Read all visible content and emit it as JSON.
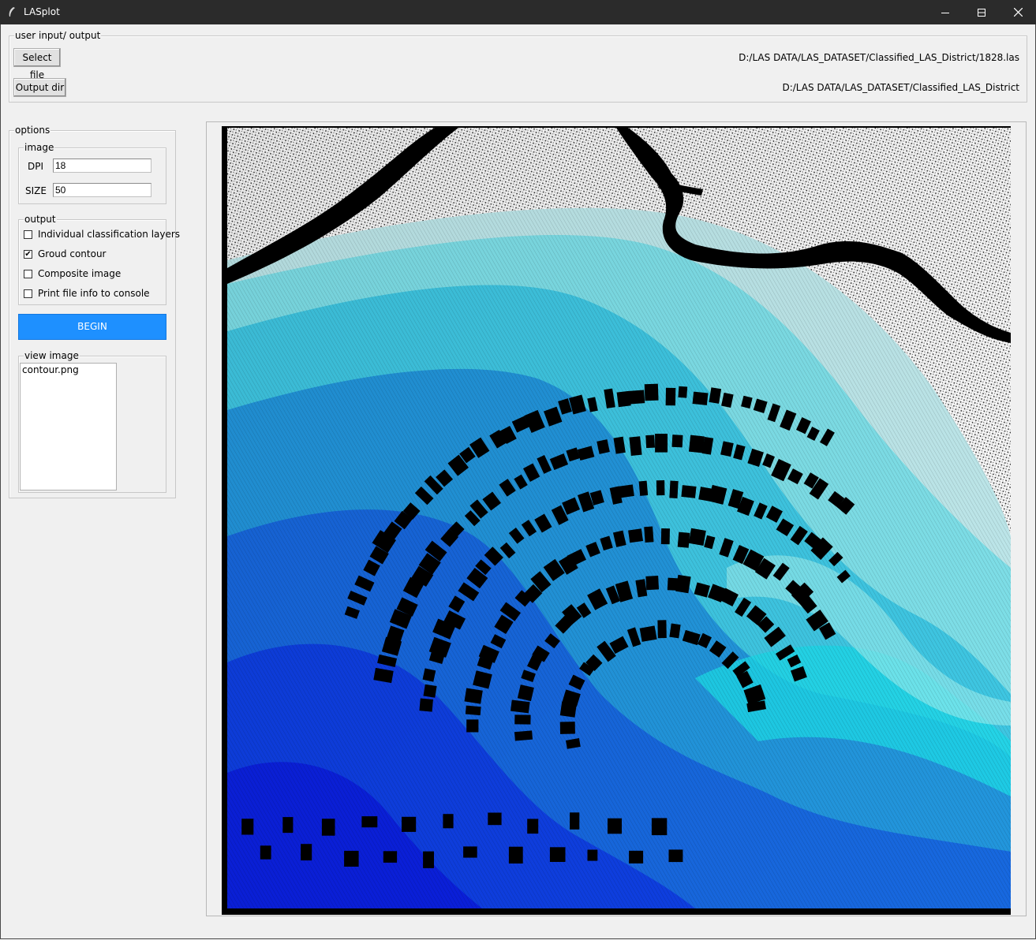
{
  "window": {
    "title": "LASplot",
    "minimize_glyph": "—",
    "maximize_glyph": "☐",
    "close_glyph": "✕"
  },
  "io_group": {
    "legend": "user input/ output",
    "select_file_label": "Select file",
    "output_dir_label": "Output dir",
    "input_path": "D:/LAS DATA/LAS_DATASET/Classified_LAS_District/1828.las",
    "output_path": "D:/LAS DATA/LAS_DATASET/Classified_LAS_District"
  },
  "options": {
    "legend": "options",
    "image": {
      "legend": "image",
      "dpi_label": "DPI",
      "dpi_value": "18",
      "size_label": "SIZE",
      "size_value": "50"
    },
    "output": {
      "legend": "output",
      "items": [
        {
          "label": "Individual classification layers",
          "checked": false
        },
        {
          "label": "Groud contour",
          "checked": true
        },
        {
          "label": "Composite image",
          "checked": false
        },
        {
          "label": "Print file info to console",
          "checked": false
        }
      ]
    },
    "begin_label": "BEGIN",
    "begin_color": "#1e90ff",
    "view_image": {
      "legend": "view image",
      "files": [
        "contour.png"
      ]
    }
  },
  "colors": {
    "titlebar": "#2b2b2b",
    "window_bg": "#f0f0f0",
    "contour_light": "#9ef0f0",
    "contour_cyan": "#1fd8e8",
    "contour_mid": "#2a7ae0",
    "contour_deep": "#0a1ee0",
    "building": "#000000"
  }
}
